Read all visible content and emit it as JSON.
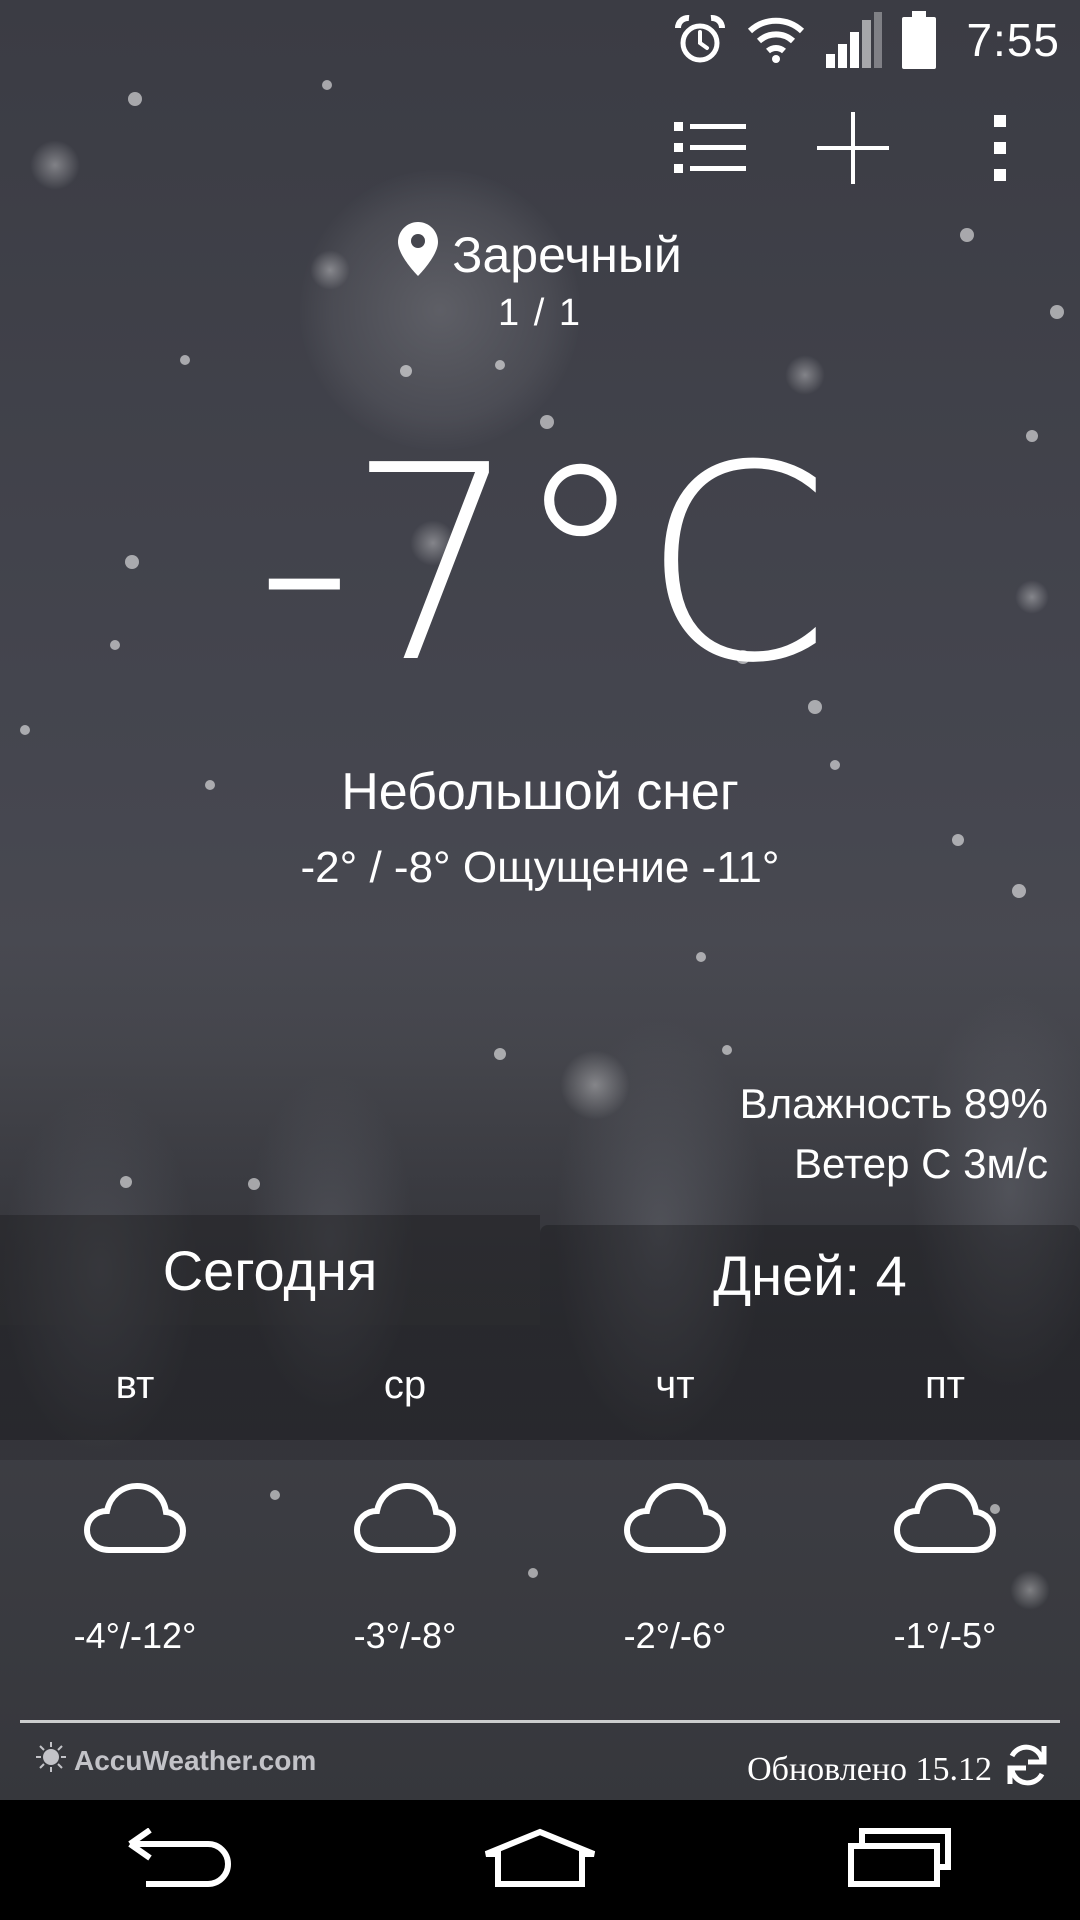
{
  "status_bar": {
    "time": "7:55",
    "icons": [
      "alarm-icon",
      "wifi-icon",
      "signal-icon",
      "battery-icon"
    ]
  },
  "actions": {
    "icons": [
      "list-icon",
      "add-icon",
      "more-vertical-icon"
    ]
  },
  "location": {
    "icon": "location-pin-icon",
    "name": "Заречный",
    "page": "1 / 1"
  },
  "current": {
    "temperature": "-7°C",
    "condition": "Небольшой снег",
    "minmax_feels": "-2° / -8° Ощущение -11°",
    "humidity": "Влажность 89%",
    "wind": "Ветер С 3м/с"
  },
  "tabs": {
    "today": "Сегодня",
    "days": "Дней: 4"
  },
  "forecast": [
    {
      "day": "вт",
      "icon": "cloud-icon",
      "temps": "-4°/-12°"
    },
    {
      "day": "ср",
      "icon": "cloud-icon",
      "temps": "-3°/-8°"
    },
    {
      "day": "чт",
      "icon": "cloud-icon",
      "temps": "-2°/-6°"
    },
    {
      "day": "пт",
      "icon": "cloud-icon",
      "temps": "-1°/-5°"
    }
  ],
  "footer": {
    "provider": "AccuWeather.com",
    "updated": "Обновлено 15.12",
    "refresh_icon": "refresh-icon"
  },
  "nav": {
    "icons": [
      "back-icon",
      "home-icon",
      "recents-icon"
    ]
  }
}
